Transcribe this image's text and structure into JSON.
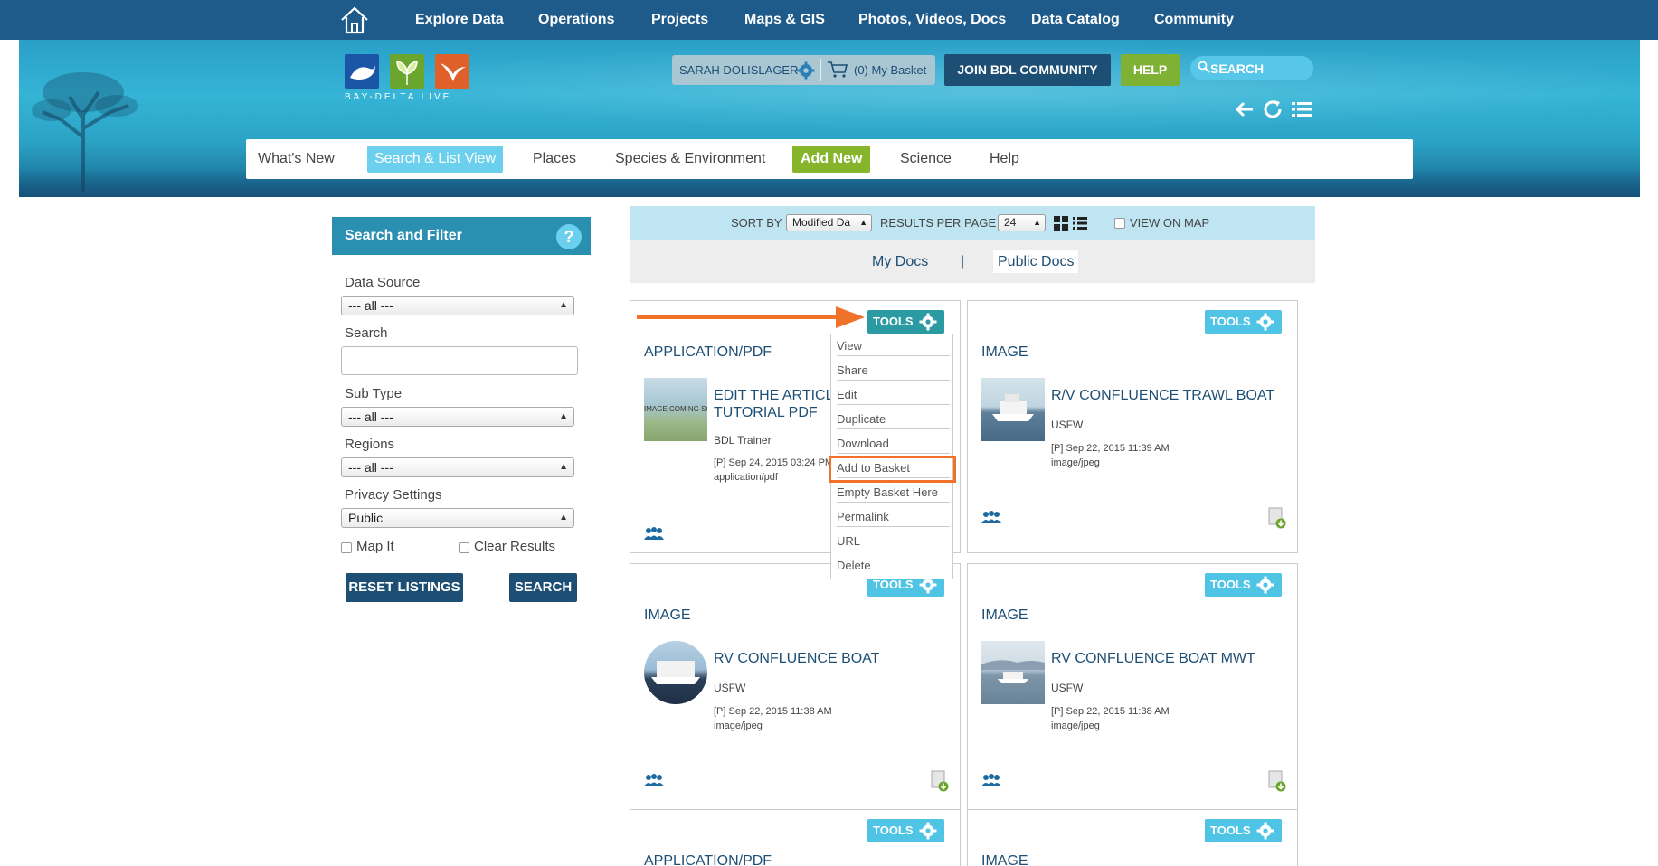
{
  "topnav": {
    "items": [
      "Explore Data",
      "Operations",
      "Projects",
      "Maps & GIS",
      "Photos, Videos, Docs",
      "Data Catalog",
      "Community"
    ]
  },
  "logo": {
    "wordmark": "BAY-DELTA LIVE"
  },
  "header": {
    "user_name": "SARAH DOLISLAGER",
    "basket": "(0) My Basket",
    "join": "JOIN BDL COMMUNITY",
    "help": "HELP",
    "search_placeholder": "SEARCH"
  },
  "subnav": {
    "items": [
      "What's New",
      "Search & List View",
      "Places",
      "Species & Environment",
      "Add New",
      "Science",
      "Help"
    ],
    "active": "Search & List View"
  },
  "sidebar": {
    "title": "Search and Filter",
    "help_glyph": "?",
    "data_source_label": "Data Source",
    "data_source_value": "--- all ---",
    "search_label": "Search",
    "search_value": "",
    "sub_type_label": "Sub Type",
    "sub_type_value": "--- all ---",
    "regions_label": "Regions",
    "regions_value": "--- all ---",
    "privacy_label": "Privacy Settings",
    "privacy_value": "Public",
    "map_it": "Map It",
    "clear_results": "Clear Results",
    "reset": "RESET LISTINGS",
    "search_btn": "SEARCH"
  },
  "sortbar": {
    "sort_by": "SORT BY",
    "sort_value": "Modified Da",
    "results_per_page": "RESULTS PER PAGE",
    "results_value": "24",
    "view_on_map": "VIEW ON MAP"
  },
  "docs": {
    "my_docs": "My Docs",
    "sep": "|",
    "public_docs": "Public Docs"
  },
  "tools_label": "TOOLS",
  "cards": [
    {
      "type": "APPLICATION/PDF",
      "title": "EDIT THE ARTICLE TUTORIAL PDF",
      "author": "BDL Trainer",
      "date": "[P] Sep 24, 2015 03:24 PM",
      "mime": "application/pdf",
      "thumb_text": "IMAGE COMING SOON"
    },
    {
      "type": "IMAGE",
      "title": "R/V CONFLUENCE TRAWL BOAT",
      "author": "USFW",
      "date": "[P] Sep 22, 2015 11:39 AM",
      "mime": "image/jpeg"
    },
    {
      "type": "IMAGE",
      "title": "RV CONFLUENCE BOAT",
      "author": "USFW",
      "date": "[P] Sep 22, 2015 11:38 AM",
      "mime": "image/jpeg"
    },
    {
      "type": "IMAGE",
      "title": "RV CONFLUENCE BOAT MWT",
      "author": "USFW",
      "date": "[P] Sep 22, 2015 11:38 AM",
      "mime": "image/jpeg"
    },
    {
      "type": "APPLICATION/PDF"
    },
    {
      "type": "IMAGE"
    }
  ],
  "tools_menu": {
    "items": [
      "View",
      "Share",
      "Edit",
      "Duplicate",
      "Download",
      "Add to Basket",
      "Empty Basket Here",
      "Permalink",
      "URL",
      "Delete"
    ],
    "highlighted": "Add to Basket"
  },
  "colors": {
    "topnav": "#1e5a8a",
    "accent_blue": "#6bd0ee",
    "accent_green": "#86b52b",
    "annotation_orange": "#f0722a"
  }
}
